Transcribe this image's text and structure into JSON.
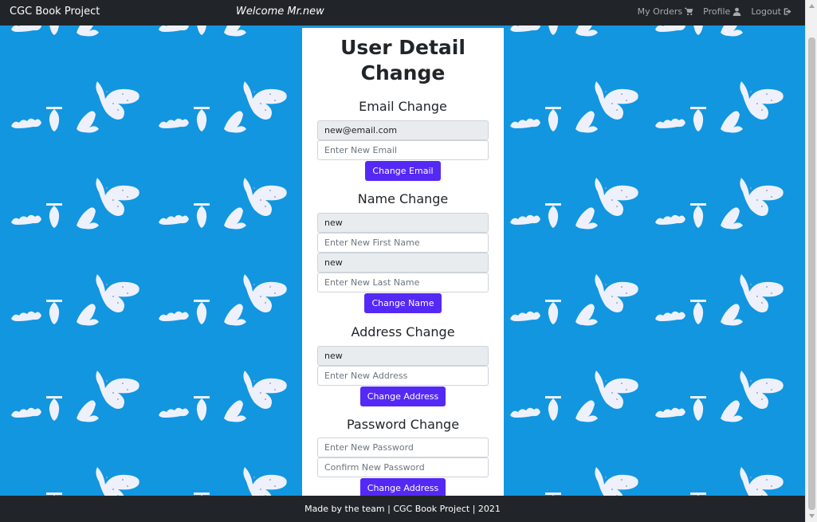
{
  "navbar": {
    "brand": "CGC Book Project",
    "welcome": "Welcome Mr.new",
    "links": [
      {
        "label": "My Orders",
        "icon": "cart-icon"
      },
      {
        "label": "Profile",
        "icon": "user-icon"
      },
      {
        "label": "Logout",
        "icon": "logout-icon"
      }
    ]
  },
  "card": {
    "title_line1": "User Detail",
    "title_line2": "Change",
    "email": {
      "title": "Email Change",
      "current_value": "new@email.com",
      "new_placeholder": "Enter New Email",
      "button": "Change Email"
    },
    "name": {
      "title": "Name Change",
      "first_current": "new",
      "first_placeholder": "Enter New First Name",
      "last_current": "new",
      "last_placeholder": "Enter New Last Name",
      "button": "Change Name"
    },
    "address": {
      "title": "Address Change",
      "current_value": "new",
      "new_placeholder": "Enter New Address",
      "button": "Change Address"
    },
    "password": {
      "title": "Password Change",
      "new_placeholder": "Enter New Password",
      "confirm_placeholder": "Confirm New Password",
      "button": "Change Address"
    }
  },
  "footer": {
    "text": "Made by the team | CGC Book Project | 2021"
  },
  "colors": {
    "navbar": "#212529",
    "background": "#1296e0",
    "button": "#5529f5",
    "card": "#ffffff"
  }
}
